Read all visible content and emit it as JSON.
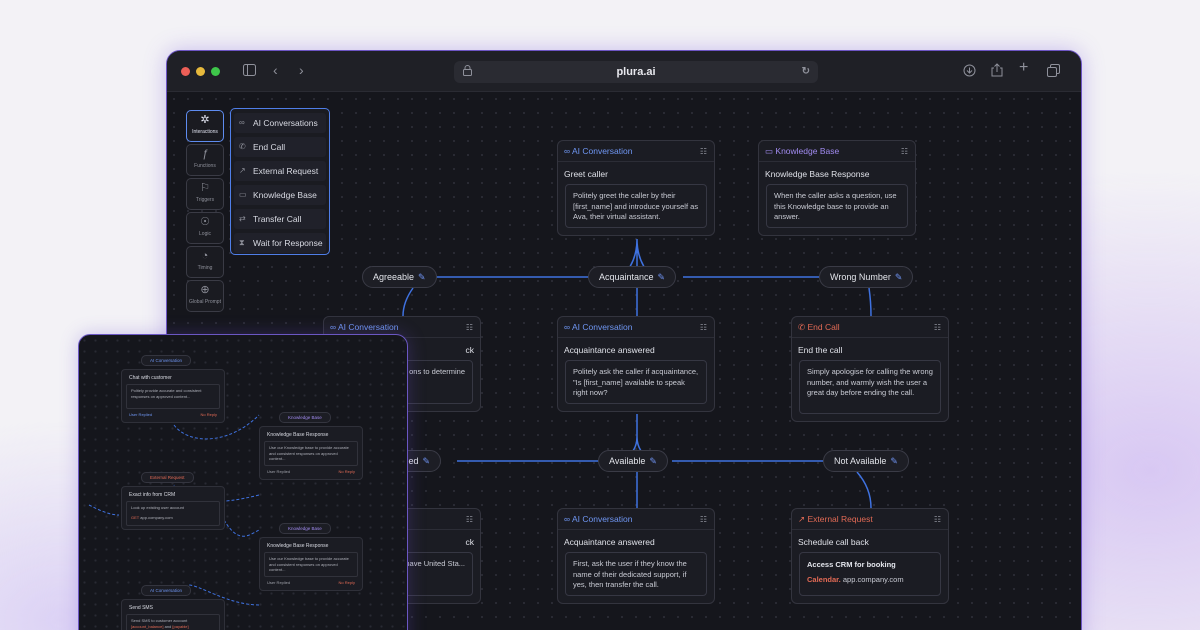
{
  "browser": {
    "url": "plura.ai"
  },
  "sidebar": {
    "buttons": [
      {
        "label": "Interactions",
        "icon": "openai-icon"
      },
      {
        "label": "Functions",
        "icon": "function-icon"
      },
      {
        "label": "Triggers",
        "icon": "flag-icon"
      },
      {
        "label": "Logic",
        "icon": "brain-icon"
      },
      {
        "label": "Timing",
        "icon": "clock-icon"
      },
      {
        "label": "Global Prompt",
        "icon": "globe-icon"
      }
    ]
  },
  "menu": {
    "items": [
      {
        "label": "AI Conversations",
        "icon": "infinity-icon"
      },
      {
        "label": "End Call",
        "icon": "phone-icon"
      },
      {
        "label": "External Request",
        "icon": "external-link-icon"
      },
      {
        "label": "Knowledge Base",
        "icon": "book-icon"
      },
      {
        "label": "Transfer Call",
        "icon": "transfer-icon"
      },
      {
        "label": "Wait for Response",
        "icon": "hourglass-icon"
      }
    ]
  },
  "nodes": {
    "greet": {
      "type": "AI Conversation",
      "title": "Greet caller",
      "body": "Politely greet the caller by their [first_name] and introduce yourself as Ava, their virtual assistant."
    },
    "kb": {
      "type": "Knowledge Base",
      "title": "Knowledge Base Response",
      "body": "When the caller asks a question, use this Knowledge base to provide an answer."
    },
    "left1": {
      "type": "AI Conversation",
      "title": "ck",
      "body": "the caller you ons to determine"
    },
    "acq": {
      "type": "AI Conversation",
      "title": "Acquaintance answered",
      "body": "Politely ask the caller if acquaintance, \"Is [first_name] available to speak right now?"
    },
    "end": {
      "type": "End Call",
      "title": "End the call",
      "body": "Simply apologise for calling the wrong number, and warmly wish the user a great day before ending the call."
    },
    "left2": {
      "type": "",
      "title": "ck",
      "body": "the person's they have United Sta..."
    },
    "acq2": {
      "type": "AI Conversation",
      "title": "Acquaintance answered",
      "body": "First, ask the user if they know the name of their dedicated support, if yes, then transfer the call."
    },
    "ext": {
      "type": "External Request",
      "title": "Schedule call back",
      "box_title": "Access CRM for booking",
      "link_prefix": "Calendar.",
      "link_url": "app.company.com"
    }
  },
  "pills": {
    "agreeable": "Agreeable",
    "acquaintance": "Acquaintance",
    "wrong": "Wrong Number",
    "confirmed": "rmed",
    "available": "Available",
    "not_available": "Not Available"
  },
  "mini": {
    "t1": "AI Conversation",
    "n1_title": "Chat with customer",
    "n1_body": "Politely provide accurate and consistent responses on approved content...",
    "n1_left": "User Replied",
    "n1_right": "No Reply",
    "t2": "Knowledge Base",
    "n2_title": "Knowledge Base Response",
    "n2_body": "Use our Knowledge base to provide accurate and consistent responses on approved content...",
    "n2_left": "User Replied",
    "n2_right": "No Reply",
    "t3": "External Request",
    "n3_title": "Exact info from CRM",
    "n3_body": "Look up existing user account",
    "n3_method": "GET",
    "n3_url": "app.company.com",
    "t4": "Knowledge Base",
    "n4_title": "Knowledge Base Response",
    "n4_body": "Use our Knowledge base to provide accurate and consistent responses on approved content...",
    "n4_left": "User Replied",
    "n4_right": "No Reply",
    "t5": "AI Conversation",
    "n5_title": "Send SMS",
    "n5_body": "Send SMS to customer account",
    "n5_link1": "[account_balance]",
    "n5_and": "and",
    "n5_link2": "[payable]"
  }
}
